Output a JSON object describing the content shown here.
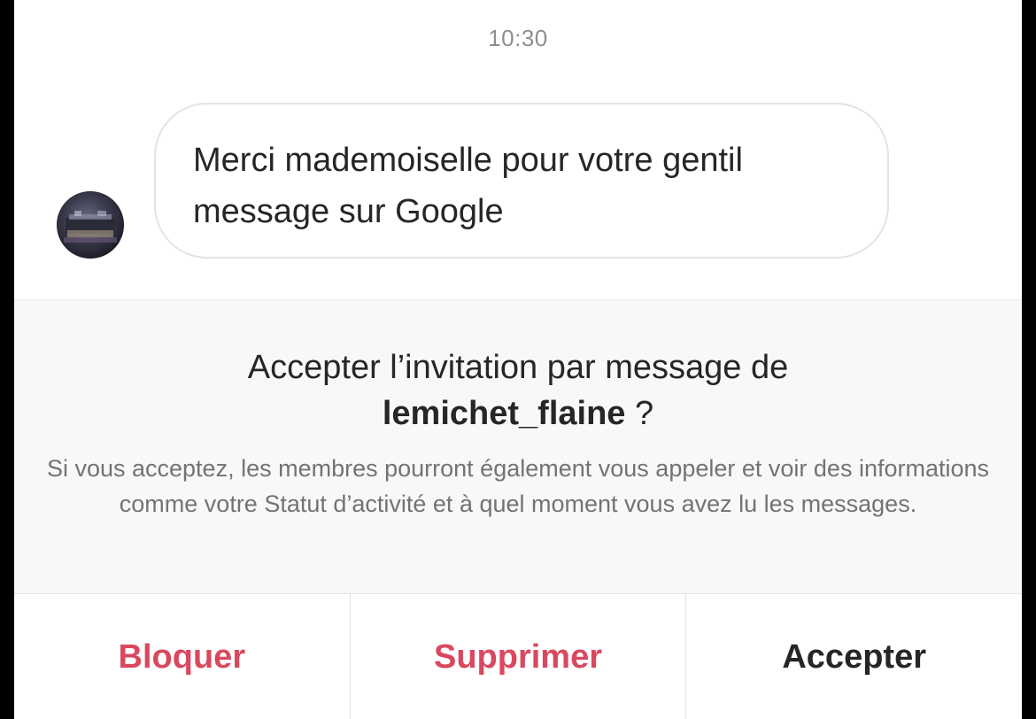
{
  "thread": {
    "timestamp": "10:30",
    "message": {
      "text": "Merci mademoiselle pour votre gentil message sur Google"
    },
    "sender_avatar_icon": "avatar-photo"
  },
  "request": {
    "title_prefix": "Accepter l’invitation par message de",
    "username": "lemichet_flaine",
    "title_suffix": " ?",
    "description": "Si vous acceptez, les membres pourront également vous appeler et voir des informations comme votre Statut d’activité et à quel moment vous avez lu les messages."
  },
  "actions": {
    "block_label": "Bloquer",
    "delete_label": "Supprimer",
    "accept_label": "Accepter"
  },
  "colors": {
    "destructive": "#d9485f",
    "primary_text": "#262626",
    "secondary_text": "#737373",
    "panel_background": "#f8f8f8"
  }
}
